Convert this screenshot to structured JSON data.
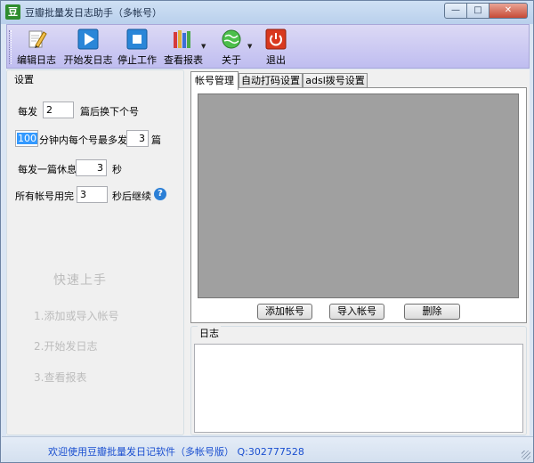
{
  "window": {
    "app_icon_char": "豆",
    "title": "豆瓣批量发日志助手（多帐号）",
    "min_glyph": "—",
    "max_glyph": "□",
    "close_glyph": "✕"
  },
  "toolbar": {
    "items": [
      {
        "label": "编辑日志",
        "icon": "edit-pencil-icon"
      },
      {
        "label": "开始发日志",
        "icon": "play-icon"
      },
      {
        "label": "停止工作",
        "icon": "stop-icon"
      },
      {
        "label": "查看报表",
        "icon": "books-report-icon"
      },
      {
        "label": "关于",
        "icon": "globe-about-icon"
      },
      {
        "label": "退出",
        "icon": "power-exit-icon"
      }
    ],
    "dropdown_arrow": "▼"
  },
  "settings": {
    "legend": "设置",
    "row1": {
      "prefix": "每发",
      "value": "2",
      "suffix": "篇后换下个号"
    },
    "row2": {
      "value1": "100",
      "middle": "分钟内每个号最多发",
      "value2": "3",
      "suffix": "篇"
    },
    "row3": {
      "prefix": "每发一篇休息",
      "value": "3",
      "suffix": "秒"
    },
    "row4": {
      "prefix": "所有帐号用完",
      "value": "3",
      "suffix": "秒后继续",
      "help": "?"
    }
  },
  "quick_start": {
    "title": "快速上手",
    "steps": [
      "1.添加或导入帐号",
      "2.开始发日志",
      "3.查看报表"
    ]
  },
  "tabs": [
    {
      "label": "帐号管理"
    },
    {
      "label": "自动打码设置"
    },
    {
      "label": "adsl拨号设置"
    }
  ],
  "account_buttons": {
    "add": "添加帐号",
    "import": "导入帐号",
    "delete": "删除"
  },
  "log": {
    "legend": "日志"
  },
  "status": {
    "text": "欢迎使用豆瓣批量发日记软件（多帐号版） Q:302777528"
  }
}
